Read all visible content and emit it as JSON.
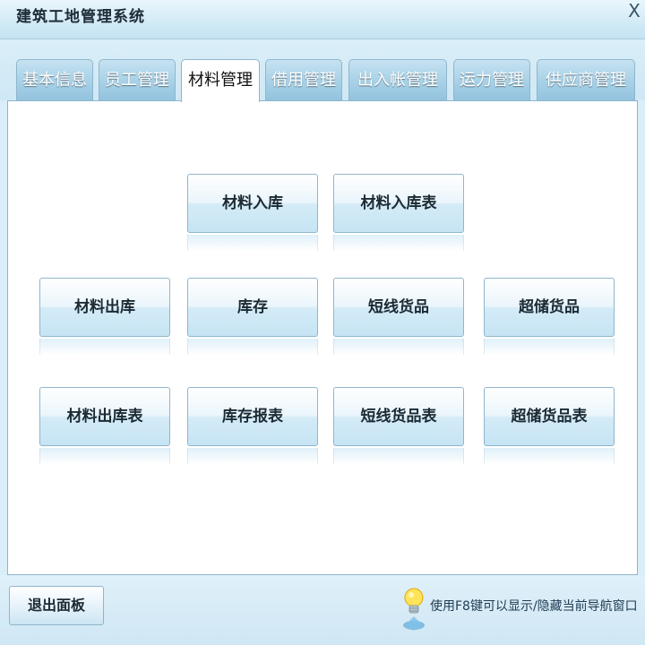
{
  "window": {
    "title": "建筑工地管理系统",
    "close_label": "X"
  },
  "tabs": [
    {
      "label": "基本信息",
      "active": false
    },
    {
      "label": "员工管理",
      "active": false
    },
    {
      "label": "材料管理",
      "active": true
    },
    {
      "label": "借用管理",
      "active": false
    },
    {
      "label": "出入帐管理",
      "active": false
    },
    {
      "label": "运力管理",
      "active": false
    },
    {
      "label": "供应商管理",
      "active": false
    }
  ],
  "panel": {
    "buttons": [
      {
        "label": "材料入库"
      },
      {
        "label": "材料入库表"
      },
      {
        "label": "材料出库"
      },
      {
        "label": "库存"
      },
      {
        "label": "短线货品"
      },
      {
        "label": "超储货品"
      },
      {
        "label": "材料出库表"
      },
      {
        "label": "库存报表"
      },
      {
        "label": "短线货品表"
      },
      {
        "label": "超储货品表"
      }
    ]
  },
  "footer": {
    "exit_label": "退出面板",
    "hint_icon": "lightbulb-icon",
    "hint_text": "使用F8键可以显示/隐藏当前导航窗口"
  },
  "colors": {
    "tab_inactive": "#a9d2e8",
    "tab_text": "#ffffff",
    "border": "#8fb6cc",
    "background": "#d9eef8"
  }
}
